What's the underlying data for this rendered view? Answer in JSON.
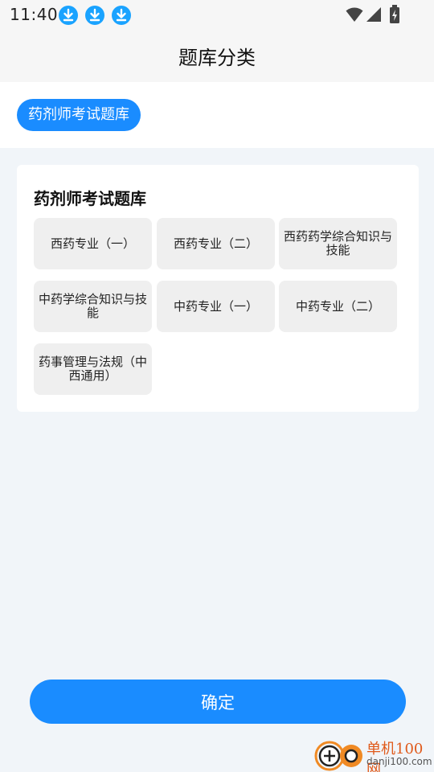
{
  "status_bar": {
    "time": "11:40",
    "icons": [
      "download-icon",
      "download-icon",
      "download-icon",
      "wifi-icon",
      "signal-icon",
      "battery-icon"
    ]
  },
  "header": {
    "title": "题库分类"
  },
  "chips": [
    {
      "label": "药剂师考试题库",
      "selected": true
    }
  ],
  "card": {
    "title": "药剂师考试题库",
    "items": [
      "西药专业（一）",
      "西药专业（二）",
      "西药药学综合知识与技能",
      "中药学综合知识与技能",
      "中药专业（一）",
      "中药专业（二）",
      "药事管理与法规（中西通用）"
    ]
  },
  "confirm_label": "确定",
  "watermark": {
    "name": "单机100网",
    "domain": "danji100.com"
  },
  "colors": {
    "accent": "#1a8cff",
    "background": "#f1f5f9",
    "item_bg": "#efefef"
  }
}
